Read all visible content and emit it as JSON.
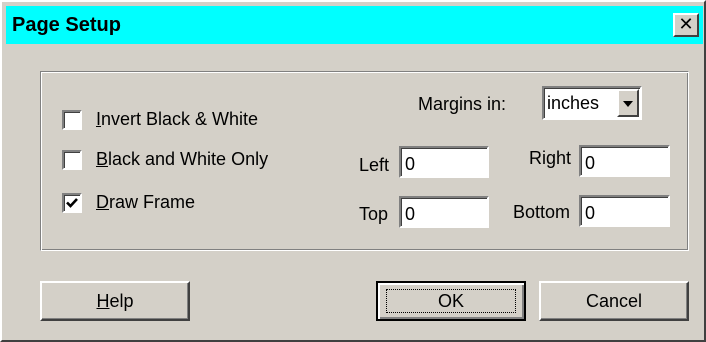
{
  "window": {
    "title": "Page Setup",
    "close_glyph": "✕"
  },
  "options": {
    "invert": {
      "first": "I",
      "rest": "nvert Black & White",
      "checked": false
    },
    "bw_only": {
      "first": "B",
      "rest": "lack and White Only",
      "checked": false
    },
    "draw_frame": {
      "first": "D",
      "rest": "raw Frame",
      "checked": true
    }
  },
  "margins": {
    "units_label": "Margins in:",
    "units_value": "inches",
    "left_label": "Left",
    "left_value": "0",
    "right_label": "Right",
    "right_value": "0",
    "top_label": "Top",
    "top_value": "0",
    "bottom_label": "Bottom",
    "bottom_value": "0"
  },
  "buttons": {
    "help_first": "H",
    "help_rest": "elp",
    "ok": "OK",
    "cancel": "Cancel"
  },
  "colors": {
    "titlebar": "#00ffff",
    "face": "#d4d0c8"
  },
  "icons": {
    "close": "close-icon",
    "check": "checkmark-icon",
    "dropdown": "dropdown-arrow-icon"
  }
}
